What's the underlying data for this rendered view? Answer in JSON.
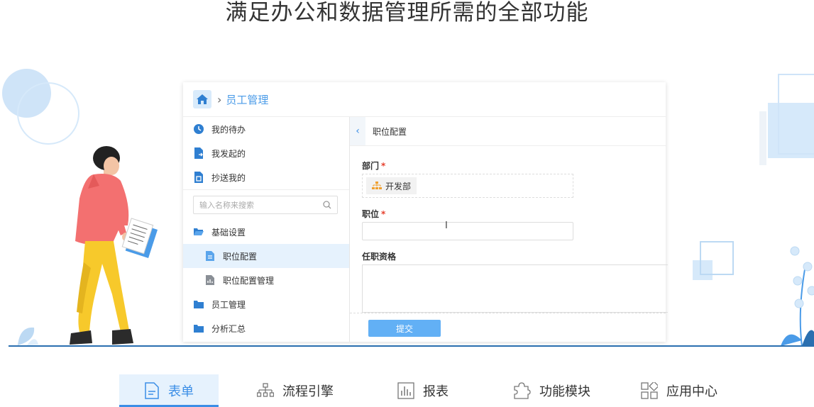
{
  "hero": {
    "title": "满足办公和数据管理所需的全部功能"
  },
  "breadcrumb": {
    "current": "员工管理"
  },
  "sidebar": {
    "top_items": [
      {
        "label": "我的待办",
        "icon": "clock-icon"
      },
      {
        "label": "我发起的",
        "icon": "doc-send-icon"
      },
      {
        "label": "抄送我的",
        "icon": "doc-copy-icon"
      }
    ],
    "search_placeholder": "输入名称来搜索",
    "groups": [
      {
        "label": "基础设置",
        "icon": "folder-open-icon"
      },
      {
        "label": "职位配置",
        "icon": "file-icon",
        "active": true
      },
      {
        "label": "职位配置管理",
        "icon": "file-chart-icon"
      },
      {
        "label": "员工管理",
        "icon": "folder-icon"
      },
      {
        "label": "分析汇总",
        "icon": "folder-icon"
      }
    ]
  },
  "form": {
    "title": "职位配置",
    "dept_label": "部门",
    "dept_value": "开发部",
    "position_label": "职位",
    "qualification_label": "任职资格",
    "required_mark": "*",
    "submit_label": "提交"
  },
  "tabs": [
    {
      "label": "表单",
      "icon": "form-icon",
      "active": true
    },
    {
      "label": "流程引擎",
      "icon": "flow-icon"
    },
    {
      "label": "报表",
      "icon": "report-icon"
    },
    {
      "label": "功能模块",
      "icon": "puzzle-icon"
    },
    {
      "label": "应用中心",
      "icon": "apps-icon"
    }
  ],
  "colors": {
    "accent": "#3b8ee6",
    "button": "#62b0f5",
    "active_bg": "#e6f2fd"
  }
}
